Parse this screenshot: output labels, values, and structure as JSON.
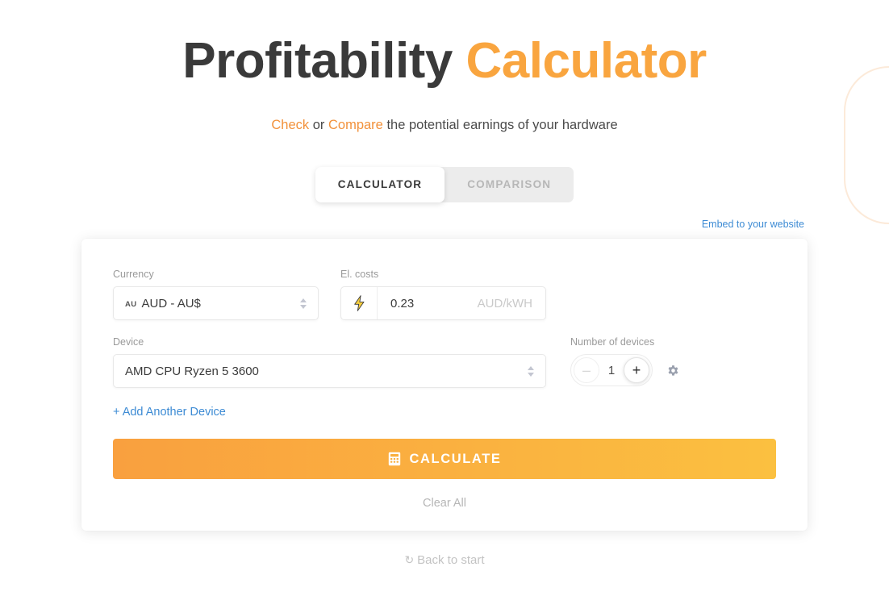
{
  "header": {
    "title_part1": "Profitability ",
    "title_part2": "Calculator",
    "subtitle_check": "Check",
    "subtitle_or": " or ",
    "subtitle_compare": "Compare",
    "subtitle_rest": " the potential earnings of your hardware"
  },
  "tabs": [
    {
      "label": "CALCULATOR",
      "active": true
    },
    {
      "label": "COMPARISON",
      "active": false
    }
  ],
  "embed": {
    "label": "Embed to your website"
  },
  "form": {
    "currency": {
      "label": "Currency",
      "flag_code": "AU",
      "value": "AUD - AU$"
    },
    "electricity": {
      "label": "El. costs",
      "icon": "lightning-bolt-icon",
      "value": "0.23",
      "placeholder": "0.00",
      "unit": "AUD/kWH"
    },
    "device": {
      "label": "Device",
      "value": "AMD CPU Ryzen 5 3600"
    },
    "devices_count": {
      "label": "Number of devices",
      "value": "1",
      "minus": "–",
      "plus": "+",
      "settings_icon": "gear-icon"
    },
    "add_device_link": "+ Add Another Device",
    "calculate_button": "CALCULATE",
    "calculate_icon": "calculator-icon",
    "clear_all": "Clear All"
  },
  "footer": {
    "back_to_start": "Back to start",
    "back_icon": "reload-icon"
  },
  "colors": {
    "accent_orange": "#f9a53f",
    "link_blue": "#3d8bd4",
    "gradient_start": "#f9a03f",
    "gradient_end": "#fbc040",
    "muted_grey": "#9a9a9a",
    "deco_stroke": "#fcead9"
  }
}
